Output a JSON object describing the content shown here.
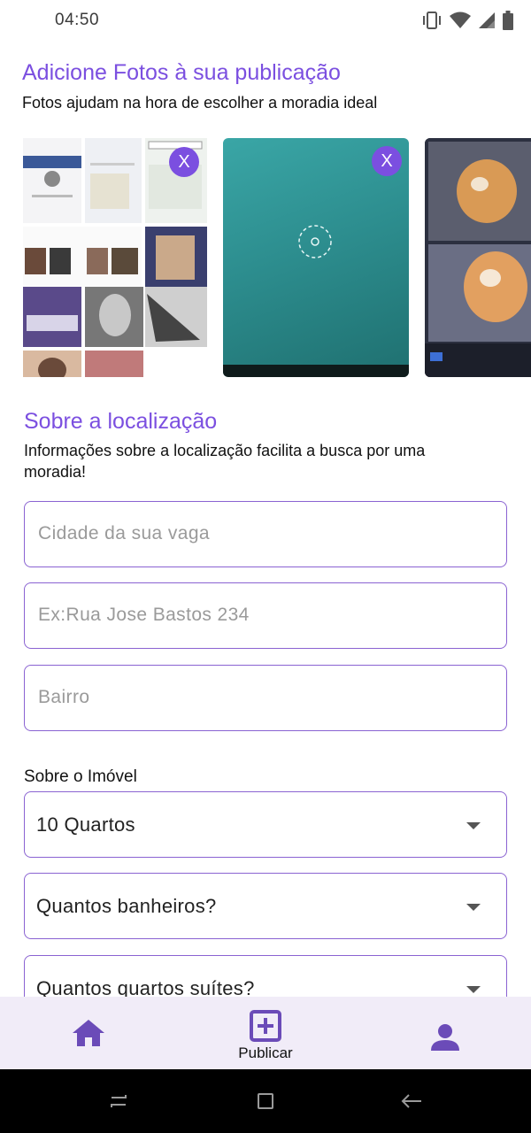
{
  "status_bar": {
    "time": "04:50",
    "icons": [
      "vibrate-icon",
      "wifi-icon",
      "signal-icon",
      "battery-icon"
    ]
  },
  "photos_section": {
    "title": "Adicione Fotos à sua publicação",
    "subtitle": "Fotos ajudam na hora de escolher a moradia ideal",
    "remove_label": "X"
  },
  "location_section": {
    "title": "Sobre a localização",
    "subtitle_line1": "Informações sobre a localização facilita a busca por uma",
    "subtitle_line2": "moradia!",
    "city_placeholder": "Cidade da sua vaga",
    "street_placeholder": "Ex:Rua Jose Bastos 234",
    "neighborhood_placeholder": "Bairro"
  },
  "property_section": {
    "label": "Sobre o Imóvel",
    "rooms_value": "10 Quartos",
    "bathrooms_value": "Quantos banheiros?",
    "suites_value": "Quantos quartos suítes?"
  },
  "bottom_nav": {
    "home_icon": "home-icon",
    "publish_label": "Publicar",
    "profile_icon": "person-icon"
  },
  "colors": {
    "accent": "#7b4fe0",
    "border": "#8a63d2",
    "nav_bg": "#f1ecf8"
  }
}
